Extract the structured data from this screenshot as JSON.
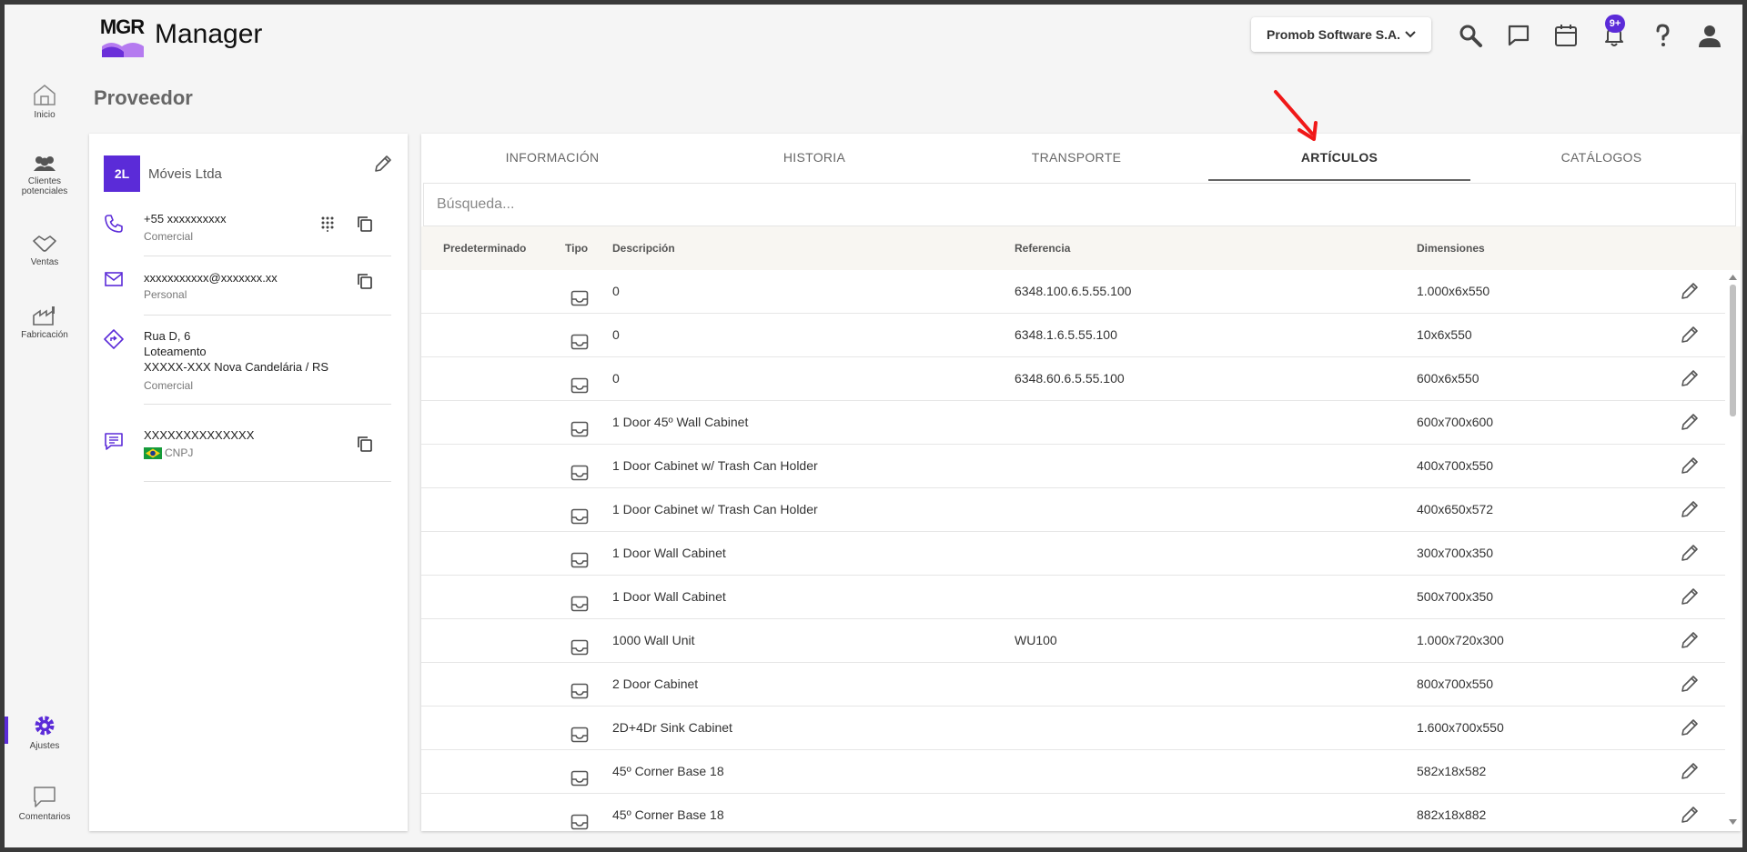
{
  "header": {
    "logo_text": "MGR",
    "app_title": "Manager",
    "company_selector": "Promob Software S.A.",
    "notification_count": "9+",
    "brand_color": "#5b2bd8"
  },
  "nav": {
    "items": [
      {
        "label": "Inicio",
        "icon": "home-icon"
      },
      {
        "label": "Clientes potenciales",
        "icon": "people-icon"
      },
      {
        "label": "Ventas",
        "icon": "handshake-icon"
      },
      {
        "label": "Fabricación",
        "icon": "factory-icon"
      },
      {
        "label": "Ajustes",
        "icon": "gear-icon"
      },
      {
        "label": "Comentarios",
        "icon": "comment-icon"
      }
    ]
  },
  "page": {
    "title": "Proveedor"
  },
  "supplier": {
    "avatar": "2L",
    "name": "Móveis Ltda",
    "phone": "+55 xxxxxxxxxx",
    "phone_type": "Comercial",
    "email": "xxxxxxxxxxx@xxxxxxx.xx",
    "email_type": "Personal",
    "address_line1": "Rua D, 6",
    "address_line2": "Loteamento",
    "address_line3": "XXXXX-XXX Nova Candelária / RS",
    "address_type": "Comercial",
    "document": "XXXXXXXXXXXXXX",
    "document_type": "CNPJ"
  },
  "tabs": [
    {
      "label": "INFORMACIÓN"
    },
    {
      "label": "HISTORIA"
    },
    {
      "label": "TRANSPORTE"
    },
    {
      "label": "ARTÍCULOS"
    },
    {
      "label": "CATÁLOGOS"
    }
  ],
  "active_tab": "ARTÍCULOS",
  "search": {
    "placeholder": "Búsqueda..."
  },
  "table": {
    "columns": [
      "Predeterminado",
      "Tipo",
      "Descripción",
      "Referencia",
      "Dimensiones"
    ],
    "rows": [
      {
        "descripcion": "0",
        "referencia": "6348.100.6.5.55.100",
        "dimensiones": "1.000x6x550"
      },
      {
        "descripcion": "0",
        "referencia": "6348.1.6.5.55.100",
        "dimensiones": "10x6x550"
      },
      {
        "descripcion": "0",
        "referencia": "6348.60.6.5.55.100",
        "dimensiones": "600x6x550"
      },
      {
        "descripcion": "1 Door 45º Wall Cabinet",
        "referencia": "",
        "dimensiones": "600x700x600"
      },
      {
        "descripcion": "1 Door Cabinet w/ Trash Can Holder",
        "referencia": "",
        "dimensiones": "400x700x550"
      },
      {
        "descripcion": "1 Door Cabinet w/ Trash Can Holder",
        "referencia": "",
        "dimensiones": "400x650x572"
      },
      {
        "descripcion": "1 Door Wall Cabinet",
        "referencia": "",
        "dimensiones": "300x700x350"
      },
      {
        "descripcion": "1 Door Wall Cabinet",
        "referencia": "",
        "dimensiones": "500x700x350"
      },
      {
        "descripcion": "1000 Wall Unit",
        "referencia": "WU100",
        "dimensiones": "1.000x720x300"
      },
      {
        "descripcion": "2 Door Cabinet",
        "referencia": "",
        "dimensiones": "800x700x550"
      },
      {
        "descripcion": "2D+4Dr Sink Cabinet",
        "referencia": "",
        "dimensiones": "1.600x700x550"
      },
      {
        "descripcion": "45º Corner Base 18",
        "referencia": "",
        "dimensiones": "582x18x582"
      },
      {
        "descripcion": "45º Corner Base 18",
        "referencia": "",
        "dimensiones": "882x18x882"
      }
    ]
  }
}
